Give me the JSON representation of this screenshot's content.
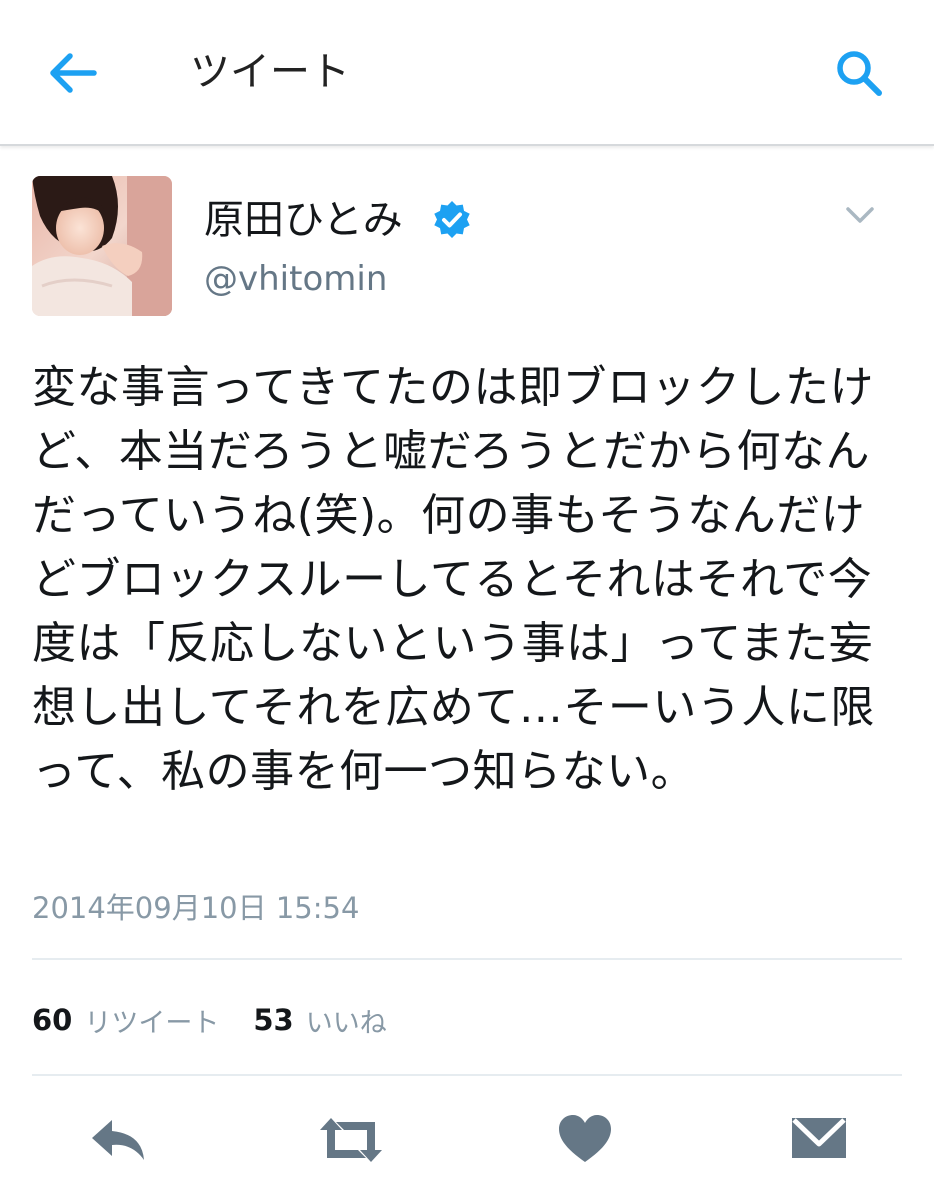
{
  "header": {
    "title": "ツイート",
    "back_icon": "arrow-left-icon",
    "search_icon": "search-icon",
    "accent_color": "#1da1f2"
  },
  "tweet": {
    "author": {
      "display_name": "原田ひとみ",
      "handle": "@vhitomin",
      "verified": true
    },
    "text": "変な事言ってきてたのは即ブロックしたけど、本当だろうと嘘だろうとだから何なんだっていうね(笑)。何の事もそうなんだけどブロックスルーしてるとそれはそれで今度は「反応しないという事は」ってまた妄想し出してそれを広めて…そーいう人に限って、私の事を何一つ知らない。",
    "timestamp": "2014年09月10日 15:54",
    "stats": {
      "retweets_count": "60",
      "retweets_label": "リツイート",
      "likes_count": "53",
      "likes_label": "いいね"
    }
  },
  "actions": [
    "reply-icon",
    "retweet-icon",
    "heart-icon",
    "message-icon"
  ],
  "colors": {
    "verified_badge": "#1da1f2",
    "action_icon": "#657786",
    "secondary_text": "#8899a6"
  }
}
